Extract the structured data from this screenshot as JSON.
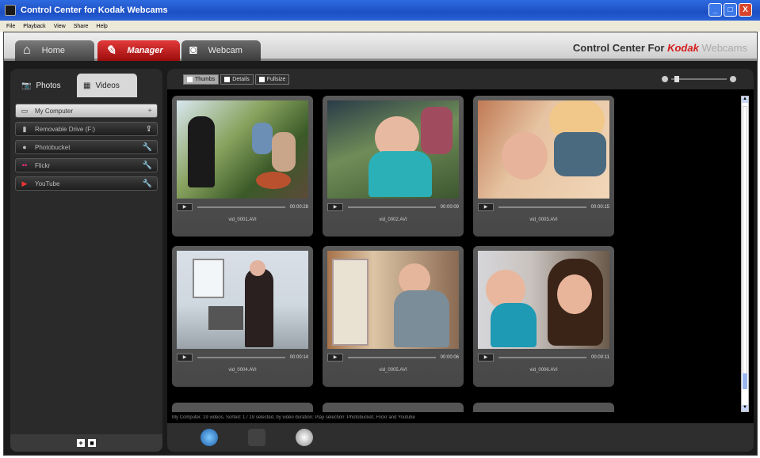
{
  "window": {
    "title": "Control Center for Kodak Webcams",
    "controls": [
      "_",
      "□",
      "X"
    ]
  },
  "menu": [
    "File",
    "Playback",
    "View",
    "Share",
    "Help"
  ],
  "main_tabs": [
    {
      "label": "Home",
      "icon": "home-icon"
    },
    {
      "label": "Manager",
      "icon": "manager-icon"
    },
    {
      "label": "Webcam",
      "icon": "webcam-icon"
    }
  ],
  "brand": {
    "prefix": "Control Center For ",
    "kodak": "Kodak",
    "suffix": " Webcams"
  },
  "sub_tabs": [
    {
      "label": "Photos",
      "icon": "camera-icon"
    },
    {
      "label": "Videos",
      "icon": "film-icon"
    }
  ],
  "sources": [
    {
      "label": "My Computer",
      "icon": "computer-icon",
      "tool": "+"
    },
    {
      "label": "Removable Drive (F:)",
      "icon": "drive-icon",
      "tool": "⇪"
    },
    {
      "label": "Photobucket",
      "icon": "photobucket-icon",
      "tool": "🔧"
    },
    {
      "label": "Flickr",
      "icon": "flickr-icon",
      "tool": "🔧"
    },
    {
      "label": "YouTube",
      "icon": "youtube-icon",
      "tool": "🔧"
    }
  ],
  "left_bottom": [
    "+",
    "■"
  ],
  "view_buttons": [
    "Thumbs",
    "Details",
    "Fullsize"
  ],
  "thumbnails": [
    {
      "duration": "00:00:28",
      "filename": "vid_0001.AVI"
    },
    {
      "duration": "00:00:09",
      "filename": "vid_0002.AVI"
    },
    {
      "duration": "00:00:15",
      "filename": "vid_0003.AVI"
    },
    {
      "duration": "00:00:14",
      "filename": "vid_0004.AVI"
    },
    {
      "duration": "00:00:06",
      "filename": "vid_0005.AVI"
    },
    {
      "duration": "00:00:11",
      "filename": "vid_0006.AVI"
    }
  ],
  "status": "My Computer, 19 videos, Sorted: 1 / 19 selected, by video duration; Play selection: Photobucket, Flickr and Youtube",
  "colors": {
    "accent_red": "#c41414",
    "titlebar_blue": "#1c4fc4",
    "panel_dark": "#2a2a2a"
  }
}
